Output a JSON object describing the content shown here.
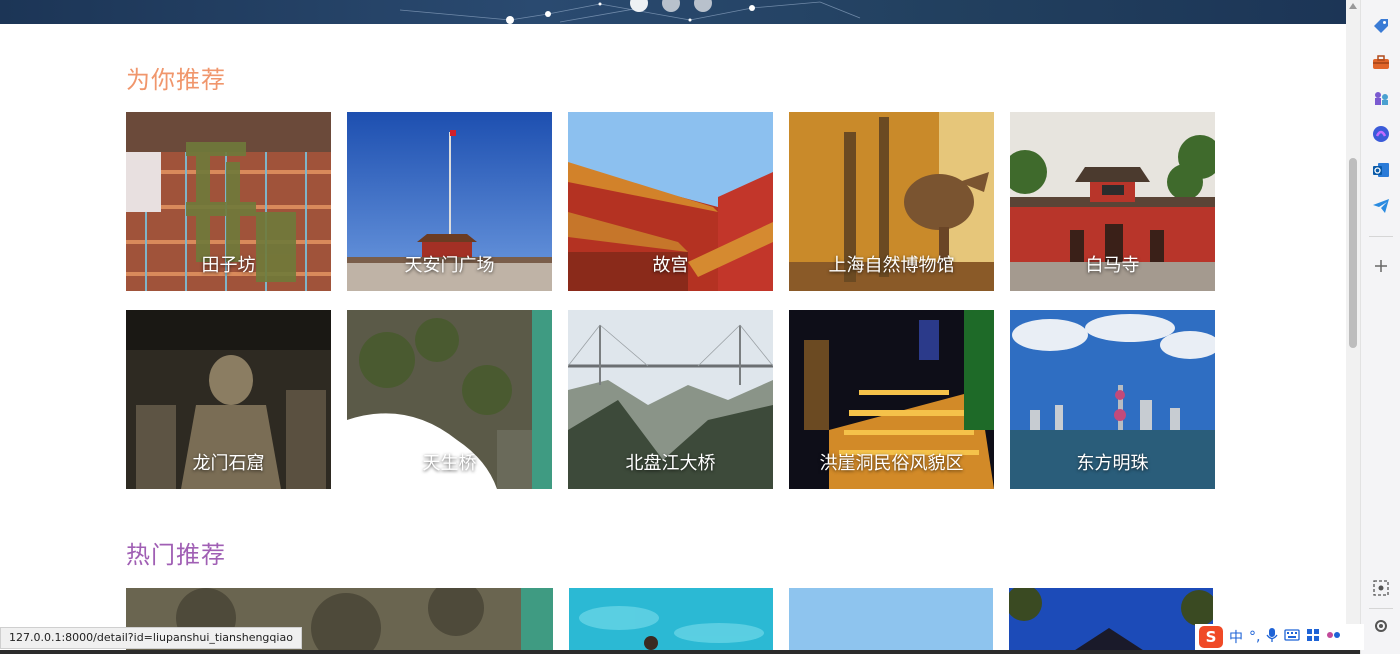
{
  "carousel": {
    "dots": [
      "slide-1",
      "slide-2",
      "slide-3"
    ],
    "active": 0
  },
  "recommend": {
    "title": "为你推荐",
    "title_color": "#f0966c",
    "cards": [
      {
        "label": "田子坊"
      },
      {
        "label": "天安门广场"
      },
      {
        "label": "故宫"
      },
      {
        "label": "上海自然博物馆"
      },
      {
        "label": "白马寺"
      },
      {
        "label": "龙门石窟"
      },
      {
        "label": "天生桥"
      },
      {
        "label": "北盘江大桥"
      },
      {
        "label": "洪崖洞民俗风貌区"
      },
      {
        "label": "东方明珠"
      }
    ]
  },
  "hot": {
    "title": "热门推荐",
    "title_color": "#a05fb4"
  },
  "status_bar": {
    "url": "127.0.0.1:8000/detail?id=liupanshui_tianshengqiao"
  },
  "ime": {
    "mode": "中",
    "logo": "S"
  },
  "side_icons": [
    "tag-icon",
    "toolbox-icon",
    "chess-icon",
    "copilot-icon",
    "outlook-icon",
    "telegram-icon",
    "add-icon",
    "screenshot-icon",
    "settings-icon"
  ]
}
